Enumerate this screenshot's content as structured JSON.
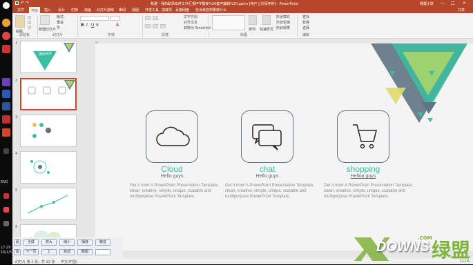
{
  "window": {
    "title": "新建 - 我的职场年终工作汇报PPT模板%20套可编辑%20.pptm [用户上次保存的] - PowerPoint",
    "user": "赛露小妖",
    "share": "共享"
  },
  "tabs": [
    "文件",
    "开始",
    "插入",
    "设计",
    "切换",
    "动画",
    "幻灯片放映",
    "审阅",
    "视图",
    "开发工具",
    "加载项",
    "百度网盘",
    "告诉我您想要做什么"
  ],
  "ribbon": {
    "groups": [
      "剪贴板",
      "幻灯片",
      "字体",
      "段落",
      "绘图",
      "编辑"
    ],
    "paste": "粘贴",
    "new_slide": "新建幻灯片",
    "reset": "重设",
    "section": "节",
    "layout": "版式",
    "text_direction": "文字方向",
    "align_text": "对齐文本",
    "smartart": "转换为 SmartArt",
    "arrange": "排列",
    "quick_styles": "快速样式",
    "shape_fill": "形状填充",
    "shape_outline": "形状轮廓",
    "shape_effects": "形状效果",
    "find": "查找",
    "replace": "替换",
    "select": "选择"
  },
  "thumbnails": {
    "numbers": [
      "1",
      "2",
      "3",
      "4",
      "5",
      "6"
    ],
    "first_title": "演示PPT"
  },
  "taskbar": {
    "lang": "ENG",
    "time": "17:29",
    "date": "16/1/5"
  },
  "slide": {
    "cards": [
      {
        "title": "Cloud",
        "subtitle": "Hello guys",
        "body": "Get it now! A PowerPoint Presentation Template, clean, creative, simple, unique, scalable and multipurpose PowerPoint Template.",
        "icon": "cloud-icon"
      },
      {
        "title": "chat",
        "subtitle": "Hello guys",
        "body": "Get it now! A PowerPoint Presentation Template, clean, creative, simple, unique, scalable and multipurpose PowerPoint Template.",
        "icon": "chat-icon"
      },
      {
        "title": "shopping",
        "subtitle": "Helloa guys",
        "body": "Get it now! A PowerPoint Presentation Template, clean, creative, simple, unique, scalable and multipurpose PowerPoint Template.",
        "icon": "cart-icon"
      }
    ]
  },
  "player": {
    "buttons_row1": [
      "全屏",
      "放大",
      "缩小",
      "播放",
      "静音"
    ],
    "buttons_row2": [
      "下一页",
      "自动",
      "截图"
    ],
    "left1": "退",
    "left2": "首",
    "left3": "上"
  },
  "status": {
    "slide_info": "幻灯片 第 2 张，共 22 张",
    "lang": "中文(中国)",
    "zoom": "111%"
  },
  "watermark": {
    "brand": "DOWNS",
    "cn": "绿盟",
    "com": ".COM"
  },
  "colors": {
    "accent": "#b7472a",
    "teal": "#3bbfa0",
    "slate": "#5f7484"
  }
}
